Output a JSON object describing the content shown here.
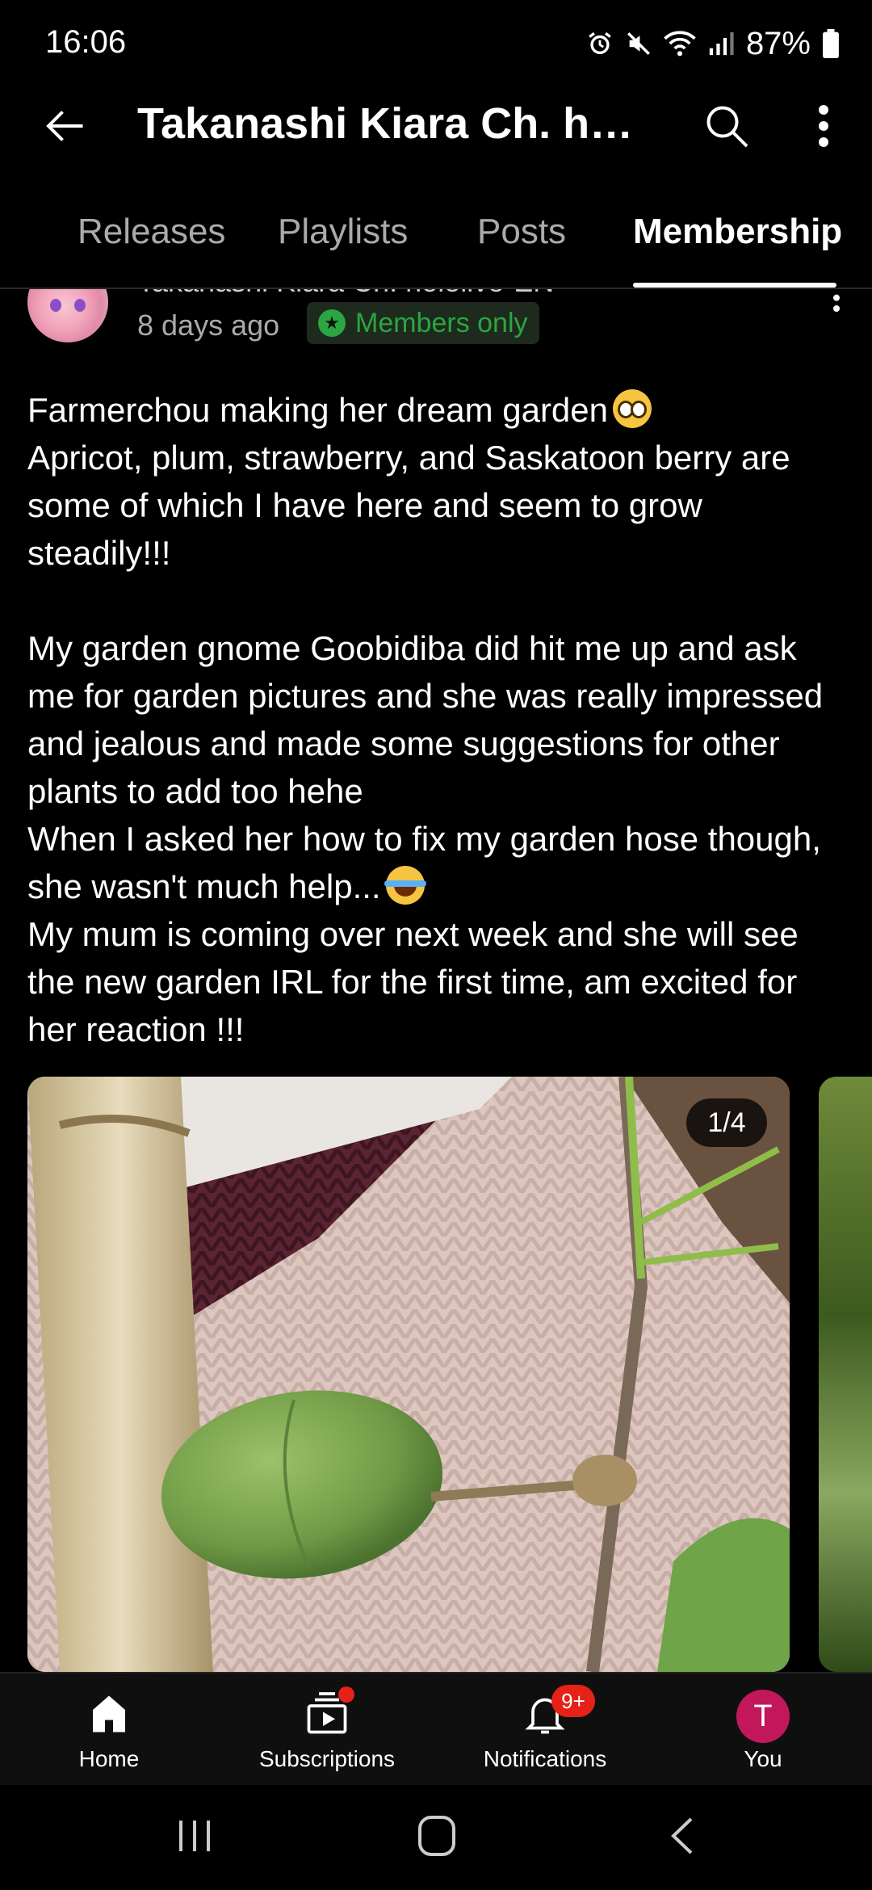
{
  "status_bar": {
    "time": "16:06",
    "battery": "87%",
    "icons": [
      "alarm-icon",
      "mute-icon",
      "wifi-icon",
      "signal-icon",
      "battery-icon"
    ]
  },
  "app_bar": {
    "title": "Takanashi Kiara Ch. hololive-EN",
    "icons": [
      "back-arrow-icon",
      "search-icon",
      "more-vert-icon"
    ]
  },
  "tabs": [
    {
      "label": "Releases",
      "active": false
    },
    {
      "label": "Playlists",
      "active": false
    },
    {
      "label": "Posts",
      "active": false
    },
    {
      "label": "Membership",
      "active": true
    }
  ],
  "post": {
    "author": "Takanashi Kiara Ch. hololive-EN",
    "age": "8 days ago",
    "badge": "Members only",
    "paragraphs": [
      "Farmerchou making her dream garden",
      "Apricot, plum, strawberry, and Saskatoon berry are some of which I have here and seem to grow steadily!!!",
      "My garden gnome Goobidiba did hit me up and ask me for garden pictures and she was really impressed and jealous and made some suggestions for other plants to add too hehe",
      "When I asked her how to fix my garden hose though, she wasn't much help...",
      "My mum is coming over next week and she will see the new garden IRL for the first time, am excited for her reaction !!!"
    ],
    "image_counter": "1/4"
  },
  "bottom_nav": [
    {
      "label": "Home",
      "icon": "home-icon"
    },
    {
      "label": "Subscriptions",
      "icon": "subscriptions-icon"
    },
    {
      "label": "Notifications",
      "icon": "bell-icon",
      "badge": "9+"
    },
    {
      "label": "You",
      "icon": "avatar",
      "initial": "T"
    }
  ],
  "colors": {
    "background": "#000000",
    "members_green": "#2ba640",
    "badge_red": "#e62117",
    "avatar_pink": "#c2185b"
  }
}
